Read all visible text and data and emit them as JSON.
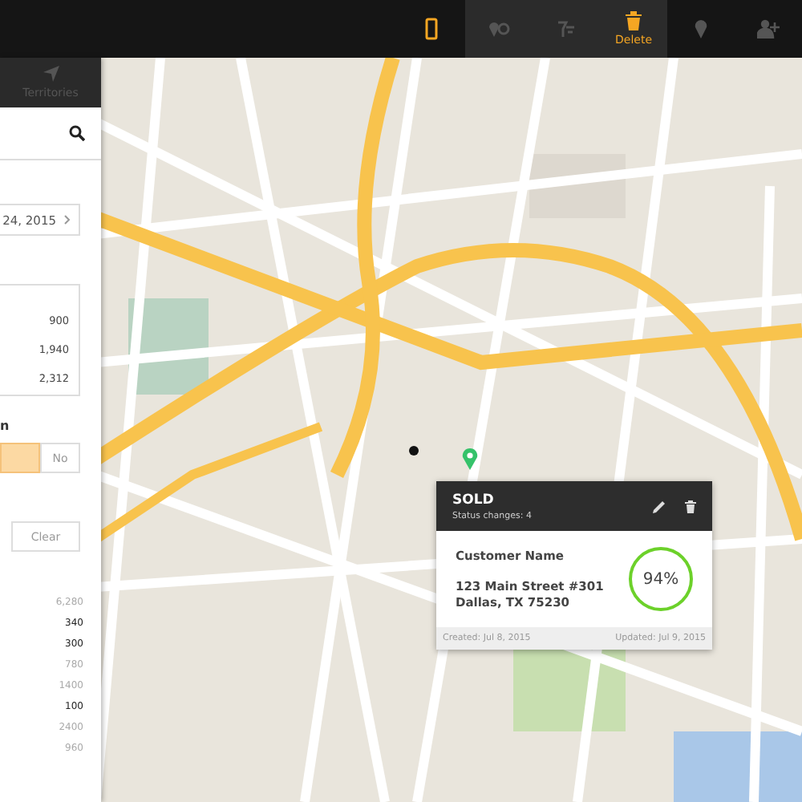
{
  "toolbar": {
    "items": [
      {
        "kind": "phone",
        "selected": true
      },
      {
        "kind": "pin-chat",
        "selected": false,
        "grouped": true
      },
      {
        "kind": "filter",
        "selected": false,
        "grouped": true
      },
      {
        "kind": "trash",
        "label": "Delete",
        "selected": true,
        "grouped": true
      },
      {
        "kind": "pin",
        "selected": false
      },
      {
        "kind": "add-user",
        "selected": false
      }
    ]
  },
  "sidebar": {
    "tab": "Territories",
    "date": "24, 2015",
    "stats": [
      "900",
      "1,940",
      "2,312"
    ],
    "section_label": "n",
    "toggle": [
      {
        "selected": true
      },
      {
        "label": "No",
        "selected": false
      }
    ],
    "clear_button": "Clear",
    "numbers": [
      {
        "text": "6,280",
        "emphasized": false
      },
      {
        "text": "340",
        "emphasized": true
      },
      {
        "text": "300",
        "emphasized": true
      },
      {
        "text": "780",
        "emphasized": false
      },
      {
        "text": "1400",
        "emphasized": false
      },
      {
        "text": "100",
        "emphasized": true
      },
      {
        "text": "2400",
        "emphasized": false
      },
      {
        "text": "960",
        "emphasized": false
      }
    ]
  },
  "popup": {
    "status": "SOLD",
    "status_changes": "Status changes: 4",
    "customer": "Customer Name",
    "address": [
      "123 Main Street #301",
      "Dallas, TX 75230"
    ],
    "percent": "94%",
    "created": "Created: Jul 8, 2015",
    "updated": "Updated: Jul 9, 2015"
  }
}
